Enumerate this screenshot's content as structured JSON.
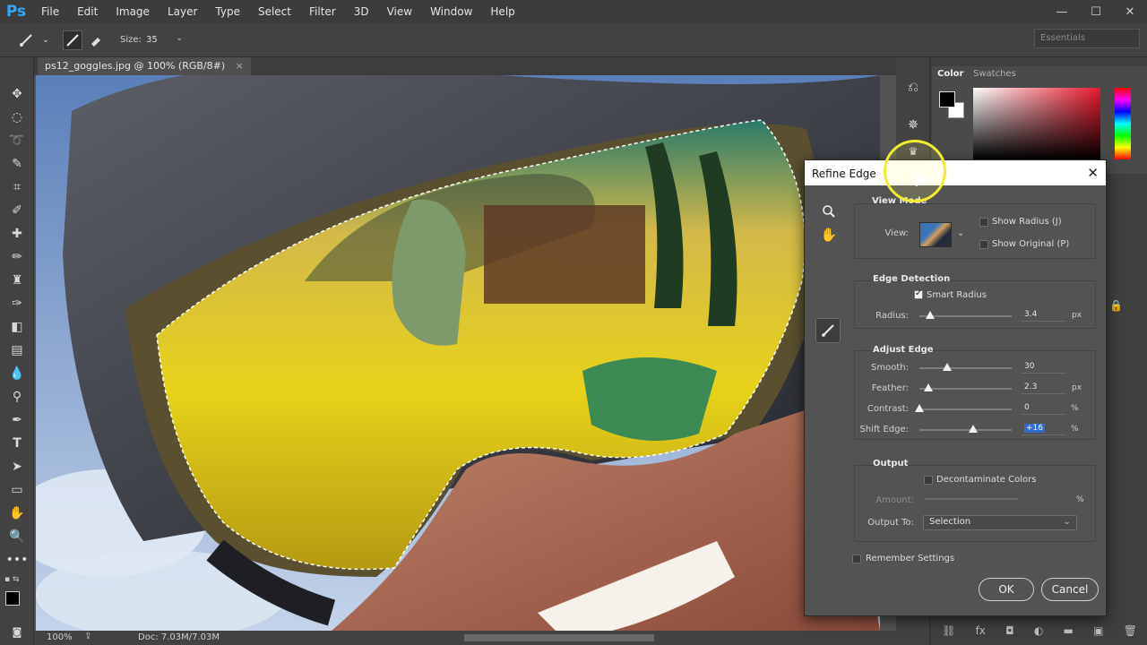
{
  "app": {
    "logo": "Ps"
  },
  "menubar": {
    "items": [
      "File",
      "Edit",
      "Image",
      "Layer",
      "Type",
      "Select",
      "Filter",
      "3D",
      "View",
      "Window",
      "Help"
    ]
  },
  "window_controls": {
    "minimize": "—",
    "maximize": "☐",
    "close": "✕"
  },
  "options_bar": {
    "size_label": "Size:",
    "size_value": "35",
    "workspace": "Essentials"
  },
  "document": {
    "tab_title": "ps12_goggles.jpg @ 100% (RGB/8#)",
    "close": "×"
  },
  "status_bar": {
    "zoom": "100%",
    "doc_info": "Doc: 7.03M/7.03M"
  },
  "color_panel": {
    "tab_color": "Color",
    "tab_swatches": "Swatches",
    "foreground": "#000000",
    "background": "#ffffff"
  },
  "dialog": {
    "title": "Refine Edge",
    "close": "✕",
    "view_mode": {
      "title": "View Mode",
      "view_label": "View:",
      "show_radius": {
        "label": "Show Radius (J)",
        "checked": false
      },
      "show_original": {
        "label": "Show Original (P)",
        "checked": false
      }
    },
    "edge_detection": {
      "title": "Edge Detection",
      "smart_radius": {
        "label": "Smart Radius",
        "checked": true
      },
      "radius": {
        "label": "Radius:",
        "value": "3.4",
        "unit": "px",
        "level": 0.12
      }
    },
    "adjust_edge": {
      "title": "Adjust Edge",
      "smooth": {
        "label": "Smooth:",
        "value": "30",
        "unit": "",
        "level": 0.3
      },
      "feather": {
        "label": "Feather:",
        "value": "2.3",
        "unit": "px",
        "level": 0.1
      },
      "contrast": {
        "label": "Contrast:",
        "value": "0",
        "unit": "%",
        "level": 0.0
      },
      "shift_edge": {
        "label": "Shift Edge:",
        "value": "+16",
        "unit": "%",
        "level": 0.58
      }
    },
    "output": {
      "title": "Output",
      "decontaminate": {
        "label": "Decontaminate Colors",
        "checked": false
      },
      "amount": {
        "label": "Amount:",
        "unit": "%"
      },
      "output_to": {
        "label": "Output To:",
        "value": "Selection"
      }
    },
    "remember_settings": {
      "label": "Remember Settings",
      "checked": false
    },
    "ok_label": "OK",
    "cancel_label": "Cancel"
  }
}
